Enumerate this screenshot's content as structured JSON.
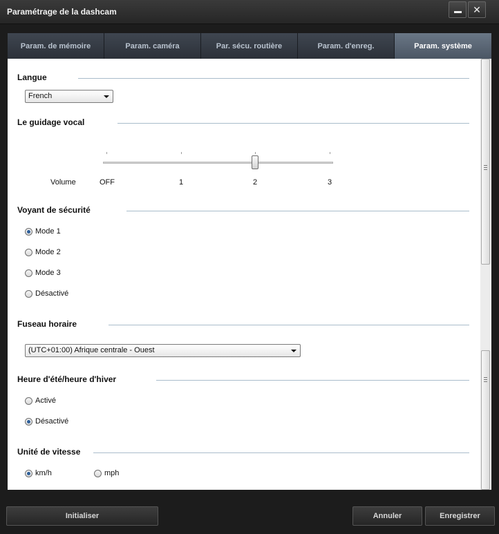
{
  "window": {
    "title": "Paramétrage de la dashcam"
  },
  "tabs": [
    {
      "label": "Param. de mémoire"
    },
    {
      "label": "Param. caméra"
    },
    {
      "label": "Par. sécu. routière"
    },
    {
      "label": "Param. d'enreg."
    },
    {
      "label": "Param. système",
      "active": true
    }
  ],
  "language": {
    "title": "Langue",
    "value": "French"
  },
  "voice_guidance": {
    "title": "Le guidage vocal",
    "volume_label": "Volume",
    "ticks": [
      "OFF",
      "1",
      "2",
      "3"
    ],
    "selected": "2"
  },
  "security_light": {
    "title": "Voyant de sécurité",
    "options": [
      "Mode 1",
      "Mode 2",
      "Mode 3",
      "Désactivé"
    ],
    "selected": "Mode 1"
  },
  "timezone": {
    "title": "Fuseau horaire",
    "value": "(UTC+01:00) Afrique centrale - Ouest"
  },
  "dst": {
    "title": "Heure d'été/heure d'hiver",
    "options": [
      "Activé",
      "Désactivé"
    ],
    "selected": "Désactivé"
  },
  "speed_unit": {
    "title": "Unité de vitesse",
    "options": [
      "km/h",
      "mph"
    ],
    "selected": "km/h"
  },
  "buttons": {
    "reset": "Initialiser",
    "cancel": "Annuler",
    "save": "Enregistrer"
  },
  "colors": {
    "active_tab": "#5b6775",
    "radio_checked": "#2d5f9a",
    "section_line": "#a9bccb"
  }
}
